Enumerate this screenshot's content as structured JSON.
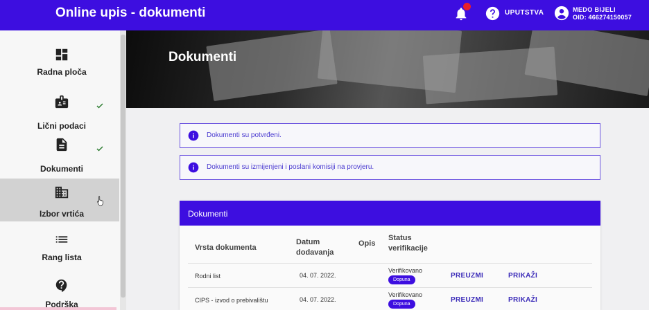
{
  "header": {
    "title": "Online upis - dokumenti",
    "help_label": "UPUTSTVA",
    "user_name": "MEDO BIJELI",
    "user_oid": "OID: 466274150057"
  },
  "sidebar": {
    "items": [
      {
        "label": "Radna ploča",
        "icon": "dashboard-icon",
        "checked": false
      },
      {
        "label": "Lični podaci",
        "icon": "id-badge-icon",
        "checked": true
      },
      {
        "label": "Dokumenti",
        "icon": "document-icon",
        "checked": true
      },
      {
        "label": "Izbor vrtića",
        "icon": "building-icon",
        "checked": false,
        "active": true
      },
      {
        "label": "Rang lista",
        "icon": "list-icon",
        "checked": false
      },
      {
        "label": "Podrška",
        "icon": "support-icon",
        "checked": false
      }
    ]
  },
  "hero": {
    "title": "Dokumenti"
  },
  "alerts": [
    {
      "text": "Dokumenti su potvrđeni."
    },
    {
      "text": "Dokumenti su izmijenjeni i poslani komisiji na provjeru."
    }
  ],
  "documents": {
    "title": "Dokumenti",
    "columns": {
      "type": "Vrsta dokumenta",
      "date_1": "Datum",
      "date_2": "dodavanja",
      "desc": "Opis",
      "status_1": "Status",
      "status_2": "verifikacije"
    },
    "rows": [
      {
        "type": "Rodni list",
        "date": "04. 07. 2022.",
        "status": "Verifikovano",
        "badge": "Dopuna",
        "download": "PREUZMI",
        "view": "PRIKAŽI"
      },
      {
        "type": "CIPS - izvod o prebivalištu",
        "date": "04. 07. 2022.",
        "status": "Verifikovano",
        "badge": "Dopuna",
        "download": "PREUZMI",
        "view": "PRIKAŽI"
      }
    ]
  },
  "colors": {
    "primary": "#3d0ee0",
    "alert_border": "#6d55e0",
    "check": "#2e7d32",
    "notification": "#e8202a"
  }
}
